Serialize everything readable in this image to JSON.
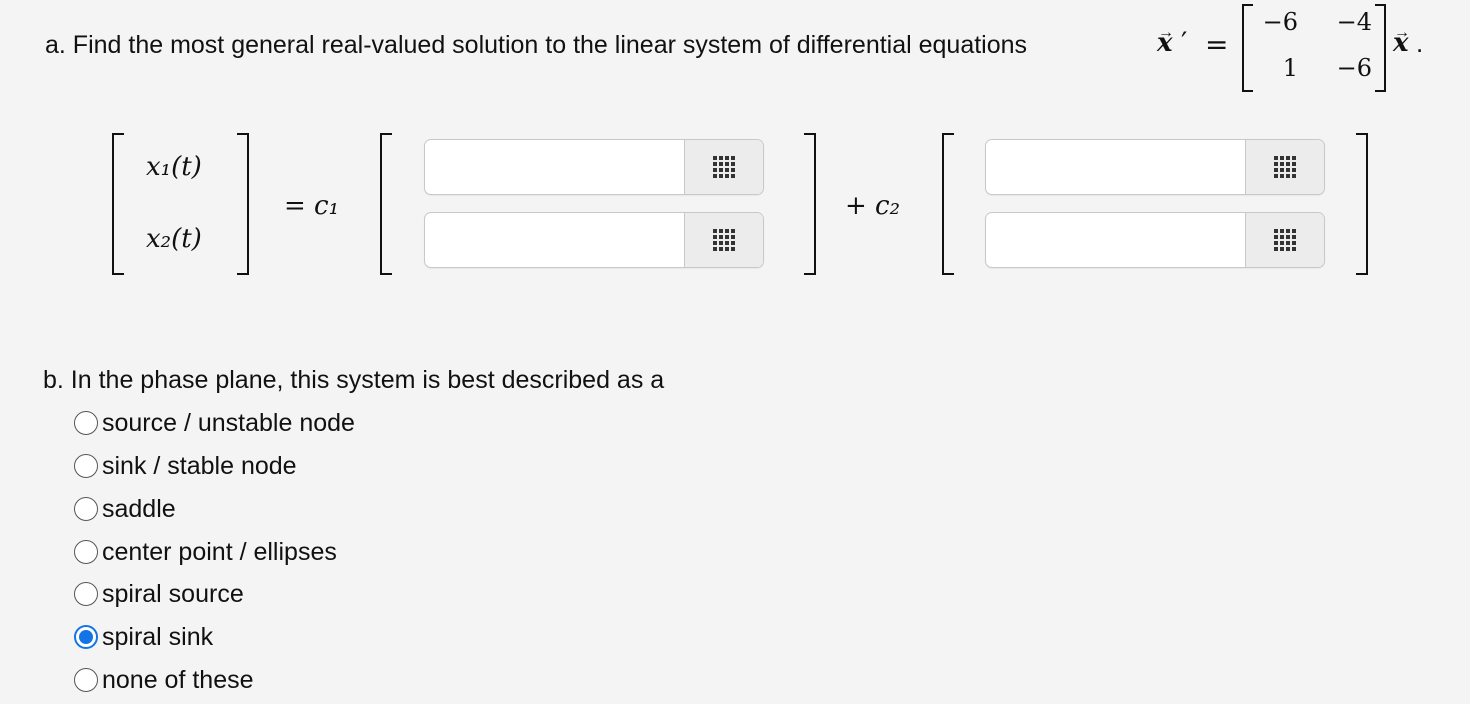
{
  "question_a": {
    "text": "a. Find the most general real-valued solution to the linear system of differential equations",
    "vec_x": "x",
    "prime": "′",
    "equals": "=",
    "matrix": [
      [
        "−6",
        "−4"
      ],
      [
        "1",
        "−6"
      ]
    ],
    "trailing_vec": "x",
    "period": "."
  },
  "solution": {
    "lhs": [
      "x₁(t)",
      "x₂(t)"
    ],
    "eq_c1": "= c₁",
    "plus_c2": "+ c₂",
    "c1_vector": [
      "",
      ""
    ],
    "c2_vector": [
      "",
      ""
    ]
  },
  "question_b": {
    "text": "b. In the phase plane, this system is best described as a",
    "options": [
      {
        "label": "source / unstable node",
        "selected": false
      },
      {
        "label": "sink / stable node",
        "selected": false
      },
      {
        "label": "saddle",
        "selected": false
      },
      {
        "label": "center point / ellipses",
        "selected": false
      },
      {
        "label": "spiral source",
        "selected": false
      },
      {
        "label": "spiral sink",
        "selected": true
      },
      {
        "label": "none of these",
        "selected": false
      }
    ]
  },
  "icons": {
    "matrix_button": "grid-icon"
  },
  "colors": {
    "selected_radio": "#1473e6",
    "background": "#f4f4f4"
  }
}
